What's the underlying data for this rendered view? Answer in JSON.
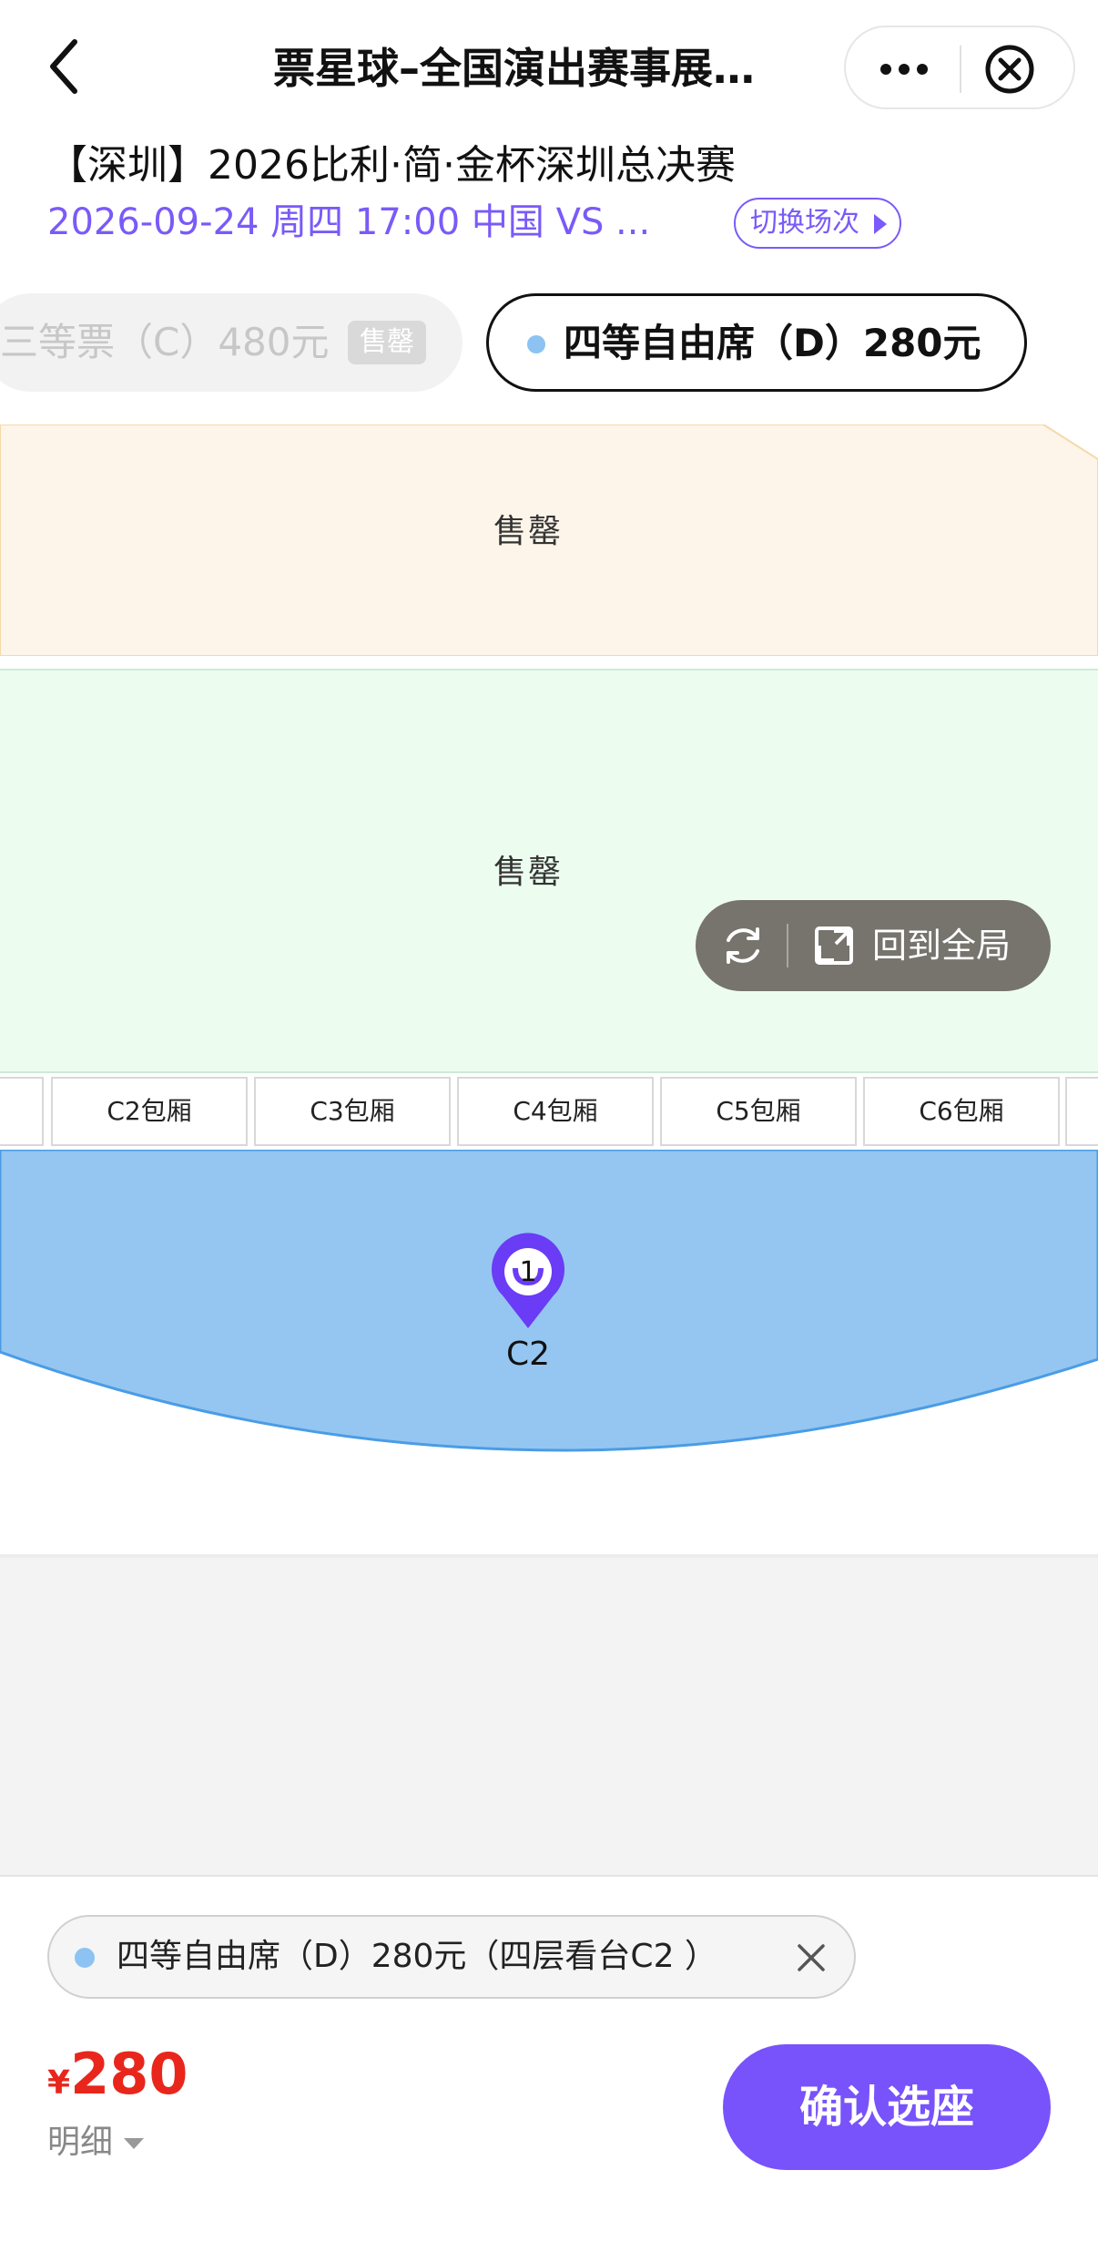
{
  "nav": {
    "title": "票星球–全国演出赛事展…",
    "back_icon": "chevron-left-icon",
    "more_icon": "more-dots-icon",
    "close_icon": "close-circle-icon"
  },
  "event": {
    "title": "【深圳】2026比利·简·金杯深圳总决赛",
    "session": "2026-09-24 周四 17:00 中国 VS ...",
    "switch_label": "切换场次"
  },
  "price_tabs": [
    {
      "label": "三等票（C）480元",
      "tag": "售罄",
      "selected": false
    },
    {
      "label": "四等自由席（D）280元",
      "selected": true
    }
  ],
  "map": {
    "zone_top_label": "售罄",
    "zone_mid_label": "售罄",
    "boxes": [
      "C2包厢",
      "C3包厢",
      "C4包厢",
      "C5包厢",
      "C6包厢"
    ],
    "pin_count": "1",
    "pin_label": "C2",
    "reset_label": "回到全局",
    "colors": {
      "zone_top": "#fdf5ea",
      "zone_mid": "#ecfdf0",
      "zone_selected": "#94c6f1",
      "pin": "#6a3cf5"
    }
  },
  "selection": {
    "chip_label": "四等自由席（D）280元（四层看台C2 ）",
    "currency": "¥",
    "price": "280",
    "detail_label": "明细",
    "confirm_label": "确认选座"
  },
  "colors": {
    "accent": "#7a5af8",
    "price_red": "#e8261c"
  }
}
